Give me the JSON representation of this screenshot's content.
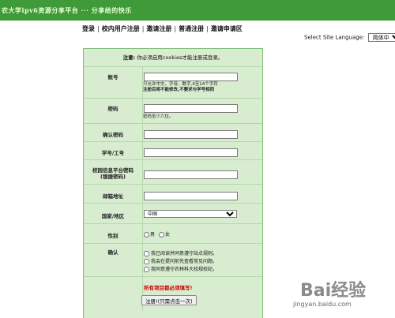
{
  "banner": {
    "title": "农大学ipv6资源分享平台 ··· 分享给的快乐"
  },
  "nav": {
    "items": [
      {
        "label": "登录"
      },
      {
        "label": "校内用户注册"
      },
      {
        "label": "邀请注册"
      },
      {
        "label": "普通注册"
      },
      {
        "label": "邀请申请区"
      }
    ],
    "separator": "|"
  },
  "language": {
    "label": "Select Site Language:",
    "selected": "简体中文"
  },
  "form": {
    "notice_prefix": "注意:",
    "notice_text": "你必须启用cookies才能注册或登录。",
    "fields": {
      "username": {
        "label": "账号",
        "hint1": "只允许中文、字母、数字,4至14个字符",
        "hint2": "注册后将不能修改,不要求与学号相同"
      },
      "password": {
        "label": "密码",
        "hint": "密码至少六位。"
      },
      "confirm": {
        "label": "确认密码"
      },
      "student_id": {
        "label": "学号/工号"
      },
      "campus_password": {
        "label_line1": "校园信息平台密码",
        "label_line2": "(银捷密码)"
      },
      "email": {
        "label": "邮箱地址"
      },
      "country": {
        "label": "国家/地区",
        "selected": "中国"
      },
      "gender": {
        "label": "性别",
        "male": "男",
        "female": "女"
      },
      "confirm_terms": {
        "label": "确认",
        "items": [
          "我已阅读并同意遵守站点规则。",
          "我会在提问前先查看常见问题。",
          "我同意遵守农林科大校规校纪。"
        ]
      }
    },
    "warning": "所有项目都必须填写!",
    "submit": "注册!(只需点击一次)"
  },
  "watermark": {
    "logo": "Bai经验",
    "url": "jingyan.baidu.com"
  }
}
